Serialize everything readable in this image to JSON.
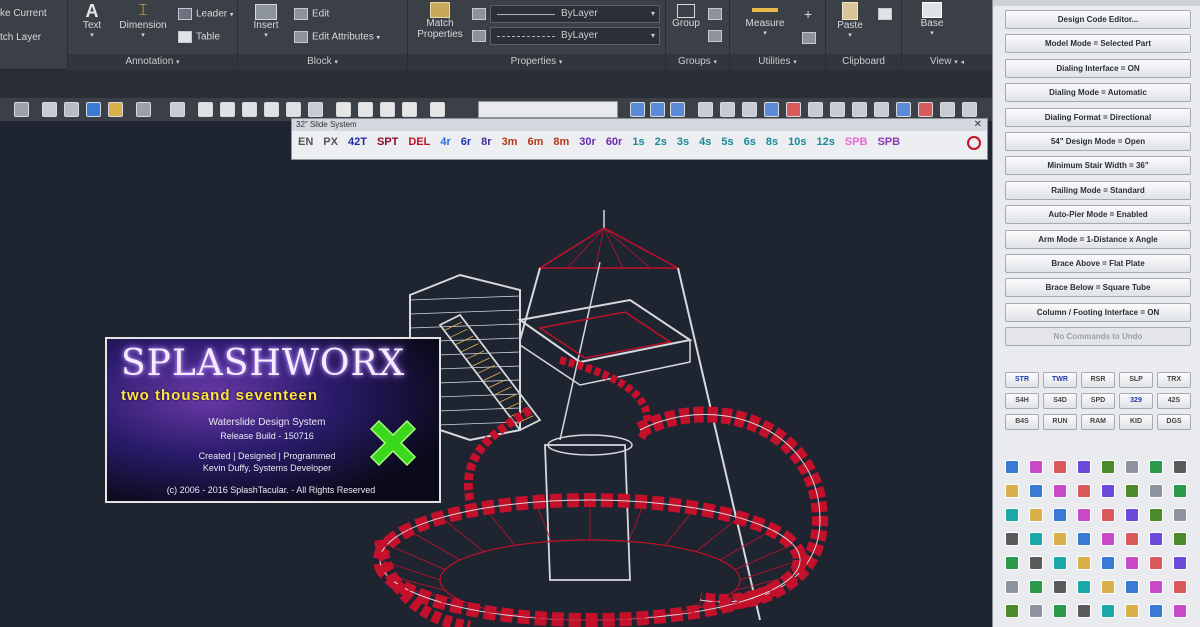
{
  "ribbon": {
    "panels": {
      "annotation": "Annotation",
      "block": "Block",
      "properties": "Properties",
      "groups": "Groups",
      "utilities": "Utilities",
      "clipboard": "Clipboard",
      "view": "View"
    },
    "layers": {
      "make_current": "ke Current",
      "match_layer": "tch Layer"
    },
    "annotation": {
      "text": "Text",
      "dimension": "Dimension",
      "leader": "Leader",
      "table": "Table"
    },
    "block": {
      "insert": "Insert",
      "edit": "Edit",
      "edit_attributes": "Edit Attributes"
    },
    "properties": {
      "match_properties_1": "Match",
      "match_properties_2": "Properties",
      "linetype_value": "ByLayer",
      "lineweight_value": "ByLayer"
    },
    "groups": {
      "group": "Group"
    },
    "utilities": {
      "measure": "Measure"
    },
    "clipboard": {
      "paste": "Paste"
    },
    "view": {
      "base": "Base"
    }
  },
  "slide_palette": {
    "title": "32\" Slide System",
    "close": "✕",
    "codes": [
      {
        "label": "EN",
        "color": "#555555"
      },
      {
        "label": "PX",
        "color": "#555555"
      },
      {
        "label": "42T",
        "color": "#1d2a9a"
      },
      {
        "label": "SPT",
        "color": "#8a0a2a"
      },
      {
        "label": "DEL",
        "color": "#c4102a"
      },
      {
        "label": "4r",
        "color": "#2b6cd6"
      },
      {
        "label": "6r",
        "color": "#1d3aa8"
      },
      {
        "label": "8r",
        "color": "#4a2a9a"
      },
      {
        "label": "3m",
        "color": "#b43a1a"
      },
      {
        "label": "6m",
        "color": "#b43a1a"
      },
      {
        "label": "8m",
        "color": "#b43a1a"
      },
      {
        "label": "30r",
        "color": "#6a2ab4"
      },
      {
        "label": "60r",
        "color": "#6a2ab4"
      },
      {
        "label": "1s",
        "color": "#1a8a9a"
      },
      {
        "label": "2s",
        "color": "#1a8a9a"
      },
      {
        "label": "3s",
        "color": "#1a8a9a"
      },
      {
        "label": "4s",
        "color": "#1a8a9a"
      },
      {
        "label": "5s",
        "color": "#1a8a9a"
      },
      {
        "label": "6s",
        "color": "#1a8a9a"
      },
      {
        "label": "8s",
        "color": "#1a8a9a"
      },
      {
        "label": "10s",
        "color": "#1a8a9a"
      },
      {
        "label": "12s",
        "color": "#1a8a9a"
      },
      {
        "label": "SPB",
        "color": "#e86ad4"
      },
      {
        "label": "SPB",
        "color": "#8a3ab4"
      }
    ]
  },
  "splash": {
    "brand": "SPLASHWORX",
    "tagline": "two thousand seventeen",
    "product": "Waterslide Design System",
    "build": "Release Build - 150716",
    "credits": "Created | Designed | Programmed",
    "author": "Kevin Duffy, Systems Developer",
    "copyright": "(c) 2006 - 2016 SplashTacular. - All Rights Reserved"
  },
  "right_panel": {
    "buttons": [
      "Design Code Editor...",
      "Model Mode = Selected Part",
      "Dialing Interface = ON",
      "Dialing Mode = Automatic",
      "Dialing Format = Directional",
      "54\" Design Mode = Open",
      "Minimum Stair Width = 36\"",
      "Railing Mode = Standard",
      "Auto-Pier Mode = Enabled",
      "Arm Mode = 1-Distance x Angle",
      "Brace Above = Flat Plate",
      "Brace Below = Square Tube",
      "Column / Footing Interface = ON",
      "No Commands to Undo"
    ],
    "codes": [
      [
        {
          "label": "STR",
          "color": "#1d3aa8"
        },
        {
          "label": "TWR",
          "color": "#1d3aa8"
        },
        {
          "label": "RSR",
          "color": "#444444"
        },
        {
          "label": "SLP",
          "color": "#444444"
        },
        {
          "label": "TRX",
          "color": "#444444"
        }
      ],
      [
        {
          "label": "S4H",
          "color": "#444444"
        },
        {
          "label": "S4D",
          "color": "#444444"
        },
        {
          "label": "SPD",
          "color": "#444444"
        },
        {
          "label": "329",
          "color": "#1d3aa8"
        },
        {
          "label": "42S",
          "color": "#444444"
        }
      ],
      [
        {
          "label": "B4S",
          "color": "#444444"
        },
        {
          "label": "RUN",
          "color": "#444444"
        },
        {
          "label": "RAM",
          "color": "#444444"
        },
        {
          "label": "KID",
          "color": "#444444"
        },
        {
          "label": "DGS",
          "color": "#444444"
        }
      ]
    ]
  }
}
